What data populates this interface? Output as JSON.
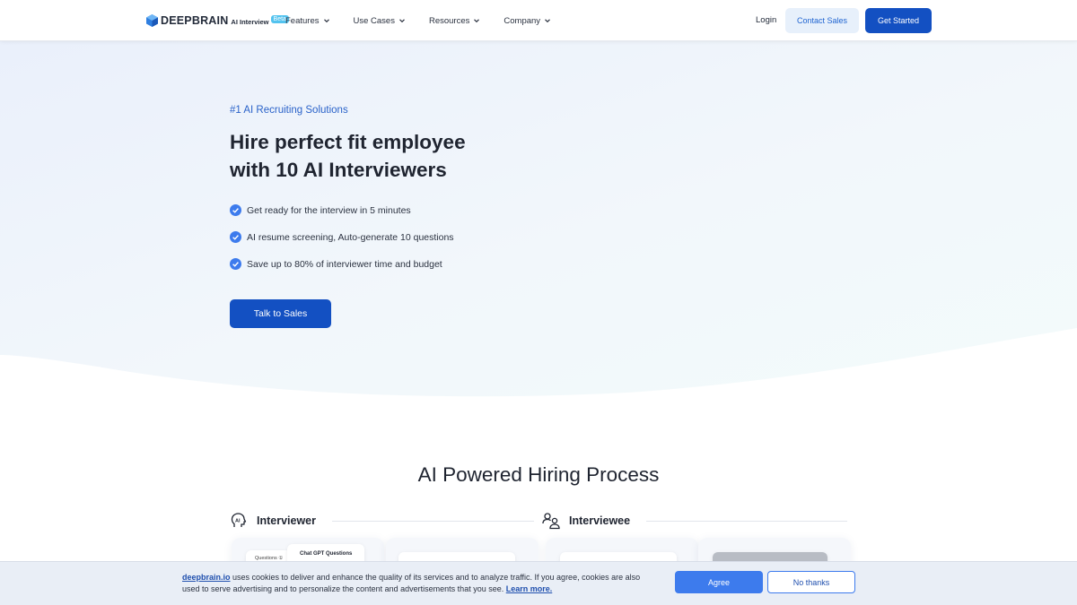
{
  "header": {
    "logo_text": "DEEPBRAIN",
    "logo_sub": "AI Interview",
    "logo_badge": "Beta",
    "nav": [
      {
        "label": "Features"
      },
      {
        "label": "Use Cases"
      },
      {
        "label": "Resources"
      },
      {
        "label": "Company"
      }
    ],
    "login_label": "Login",
    "contact_label": "Contact Sales",
    "start_label": "Get Started"
  },
  "hero": {
    "eyebrow": "#1 AI Recruiting Solutions",
    "headline_line1": "Hire perfect fit employee",
    "headline_line2": "with 10 AI Interviewers",
    "bullets": [
      "Get ready for the interview in 5 minutes",
      "AI resume screening, Auto-generate 10 questions",
      "Save up to 80% of interviewer time and budget"
    ],
    "cta_label": "Talk to Sales"
  },
  "process": {
    "title": "AI Powered Hiring Process",
    "col_left": "Interviewer",
    "col_right": "Interviewee",
    "card1_small": "Questions ①",
    "card1_title": "Chat GPT Questions"
  },
  "cookie": {
    "link_text": "deepbrain.io",
    "text_main": " uses cookies to deliver and enhance the quality of its services and to analyze traffic. If you agree, cookies are also used to serve advertising and to personalize the content and advertisements that you see. ",
    "learn_more": "Learn more.",
    "agree_label": "Agree",
    "no_label": "No thanks"
  },
  "colors": {
    "primary": "#1350c2",
    "accent_light": "#e7f0fb",
    "check": "#3d7bed"
  }
}
